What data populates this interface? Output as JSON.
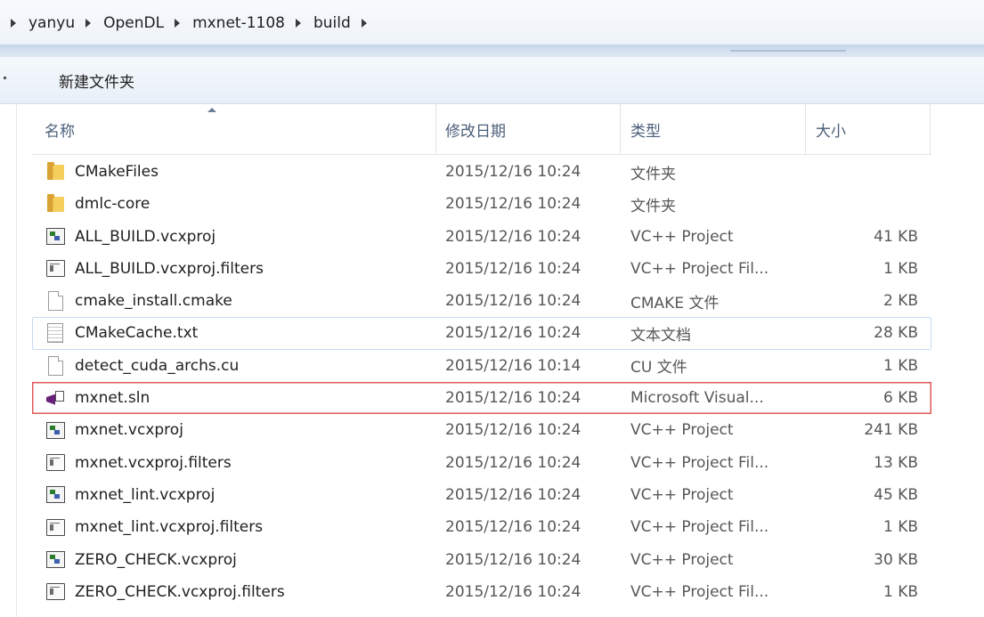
{
  "breadcrumb": [
    "yanyu",
    "OpenDL",
    "mxnet-1108",
    "build"
  ],
  "toolbar": {
    "new_folder": "新建文件夹"
  },
  "columns": {
    "name": "名称",
    "modified": "修改日期",
    "type": "类型",
    "size": "大小"
  },
  "files": [
    {
      "name": "CMakeFiles",
      "modified": "2015/12/16 10:24",
      "type": "文件夹",
      "size": "",
      "icon": "folder-icon"
    },
    {
      "name": "dmlc-core",
      "modified": "2015/12/16 10:24",
      "type": "文件夹",
      "size": "",
      "icon": "folder-icon"
    },
    {
      "name": "ALL_BUILD.vcxproj",
      "modified": "2015/12/16 10:24",
      "type": "VC++ Project",
      "size": "41 KB",
      "icon": "vcxproj-icon"
    },
    {
      "name": "ALL_BUILD.vcxproj.filters",
      "modified": "2015/12/16 10:24",
      "type": "VC++ Project Fil...",
      "size": "1 KB",
      "icon": "filters-icon"
    },
    {
      "name": "cmake_install.cmake",
      "modified": "2015/12/16 10:24",
      "type": "CMAKE 文件",
      "size": "2 KB",
      "icon": "file-icon"
    },
    {
      "name": "CMakeCache.txt",
      "modified": "2015/12/16 10:24",
      "type": "文本文档",
      "size": "28 KB",
      "icon": "text-file-icon"
    },
    {
      "name": "detect_cuda_archs.cu",
      "modified": "2015/12/16 10:14",
      "type": "CU 文件",
      "size": "1 KB",
      "icon": "file-icon"
    },
    {
      "name": "mxnet.sln",
      "modified": "2015/12/16 10:24",
      "type": "Microsoft Visual...",
      "size": "6 KB",
      "icon": "solution-icon"
    },
    {
      "name": "mxnet.vcxproj",
      "modified": "2015/12/16 10:24",
      "type": "VC++ Project",
      "size": "241 KB",
      "icon": "vcxproj-icon"
    },
    {
      "name": "mxnet.vcxproj.filters",
      "modified": "2015/12/16 10:24",
      "type": "VC++ Project Fil...",
      "size": "13 KB",
      "icon": "filters-icon"
    },
    {
      "name": "mxnet_lint.vcxproj",
      "modified": "2015/12/16 10:24",
      "type": "VC++ Project",
      "size": "45 KB",
      "icon": "vcxproj-icon"
    },
    {
      "name": "mxnet_lint.vcxproj.filters",
      "modified": "2015/12/16 10:24",
      "type": "VC++ Project Fil...",
      "size": "1 KB",
      "icon": "filters-icon"
    },
    {
      "name": "ZERO_CHECK.vcxproj",
      "modified": "2015/12/16 10:24",
      "type": "VC++ Project",
      "size": "30 KB",
      "icon": "vcxproj-icon"
    },
    {
      "name": "ZERO_CHECK.vcxproj.filters",
      "modified": "2015/12/16 10:24",
      "type": "VC++ Project Fil...",
      "size": "1 KB",
      "icon": "filters-icon"
    }
  ],
  "colors": {
    "highlight_border": "#e05a5a",
    "hover_border": "#c6dbf3",
    "header_text": "#4c5f7a"
  }
}
